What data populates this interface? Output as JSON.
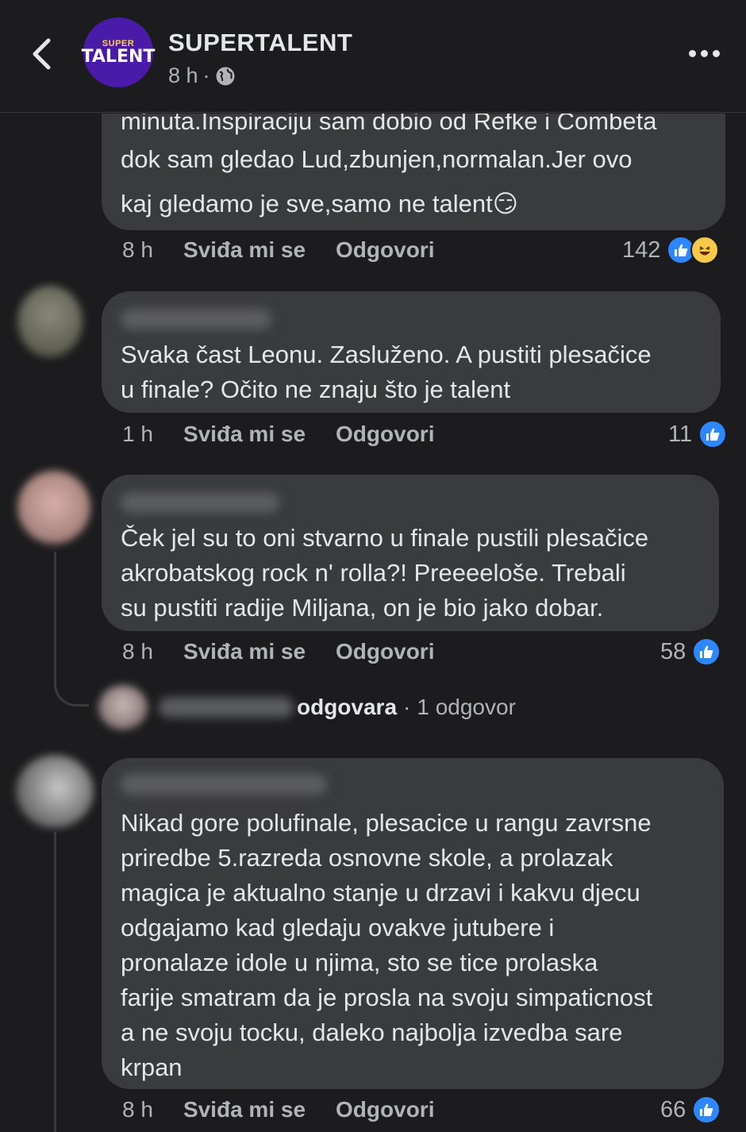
{
  "header": {
    "page_name": "SUPERTALENT",
    "time": "8 h",
    "separator": "·",
    "logo_small": "SUPER",
    "logo_big": "TALENT"
  },
  "comments": [
    {
      "text_lines": [
        "minuta.Inspiraciju sam dobio od Refke i Combeta",
        "dok sam gledao Lud,zbunjen,normalan.Jer ovo",
        "kaj gledamo je sve,samo ne talent😏"
      ],
      "time": "8 h",
      "like_label": "Sviđa mi se",
      "reply_label": "Odgovori",
      "reactions": "142",
      "reaction_icons": [
        "like-icon",
        "haha-icon"
      ]
    },
    {
      "text_lines": [
        "Svaka čast Leonu. Zasluženo. A pustiti plesačice",
        "u finale? Očito ne znaju što je talent"
      ],
      "time": "1 h",
      "like_label": "Sviđa mi se",
      "reply_label": "Odgovori",
      "reactions": "11",
      "reaction_icons": [
        "like-icon"
      ]
    },
    {
      "text_lines": [
        "Ček jel su to oni stvarno u finale pustili plesačice",
        "akrobatskog rock n' rolla?! Preeeeloše. Trebali",
        "su pustiti radije Miljana, on je bio jako dobar."
      ],
      "time": "8 h",
      "like_label": "Sviđa mi se",
      "reply_label": "Odgovori",
      "reactions": "58",
      "reaction_icons": [
        "like-icon"
      ],
      "reply_summary": {
        "action": "odgovara",
        "separator": "·",
        "count_label": "1 odgovor"
      }
    },
    {
      "text_lines": [
        "Nikad gore polufinale, plesacice u rangu zavrsne",
        "priredbe 5.razreda osnovne skole, a prolazak",
        "magica je aktualno stanje u drzavi i kakvu djecu",
        "odgajamo kad gledaju ovakve jutubere i",
        "pronalaze idole u njima, sto se tice prolaska",
        "farije smatram da je prosla na svoju simpaticnost",
        "a ne svoju tocku, daleko najbolja izvedba sare",
        "krpan"
      ],
      "time": "8 h",
      "like_label": "Sviđa mi se",
      "reply_label": "Odgovori",
      "reactions": "66",
      "reaction_icons": [
        "like-icon"
      ]
    }
  ],
  "colors": {
    "background": "#1c1c1e",
    "bubble": "#3a3b3c",
    "like_blue": "#2d88ff",
    "logo_purple": "#4a1aa8"
  }
}
